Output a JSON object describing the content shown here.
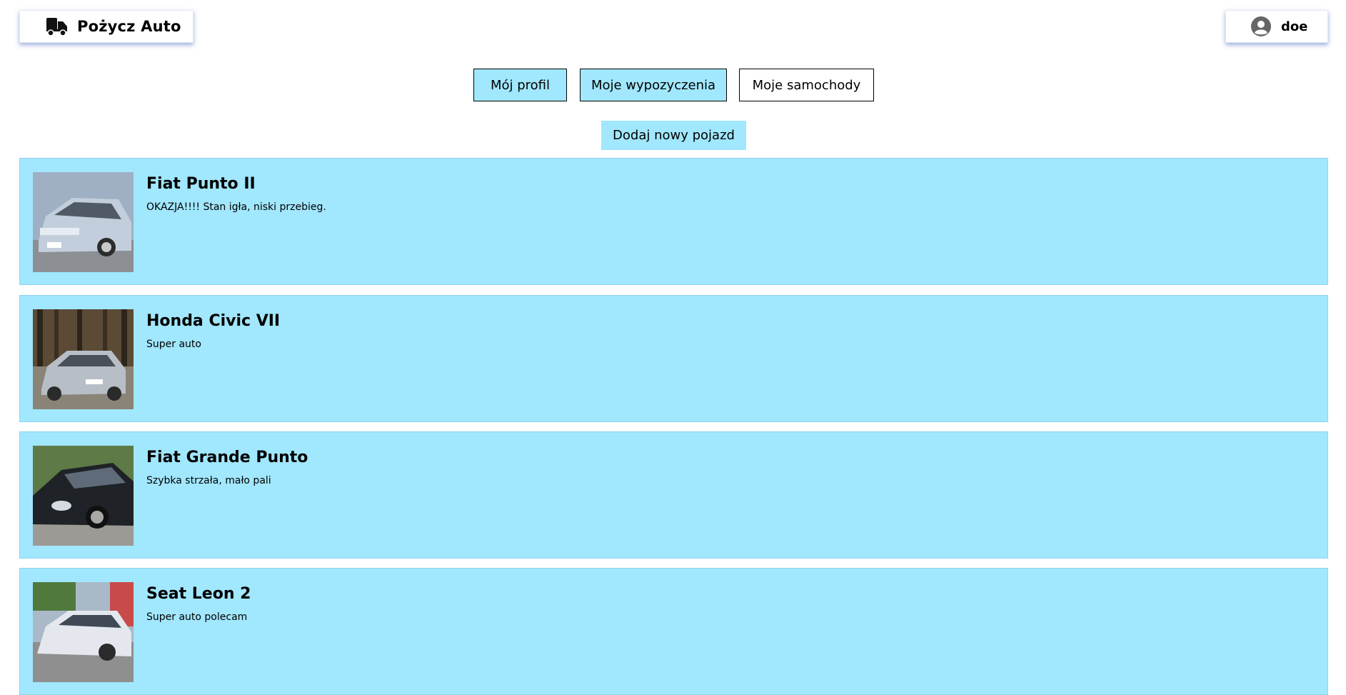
{
  "header": {
    "brand_title": "Pożycz Auto",
    "brand_icon": "truck-icon",
    "user_name": "doe",
    "user_icon": "user-circle-icon"
  },
  "tabs": [
    {
      "label": "Mój profil",
      "active": true
    },
    {
      "label": "Moje wypozyczenia",
      "active": true
    },
    {
      "label": "Moje samochody",
      "active": false
    }
  ],
  "add_vehicle_label": "Dodaj nowy pojazd",
  "cars": [
    {
      "name": "Fiat Punto II",
      "description": "OKAZJA!!!! Stan igła, niski przebieg."
    },
    {
      "name": "Honda Civic VII",
      "description": "Super auto"
    },
    {
      "name": "Fiat Grande Punto",
      "description": "Szybka strzała, mało pali"
    },
    {
      "name": "Seat Leon 2",
      "description": "Super auto polecam"
    }
  ],
  "colors": {
    "accent": "#a1e7fd",
    "card_border": "#8fd6ee",
    "shadow": "#506ec8"
  }
}
